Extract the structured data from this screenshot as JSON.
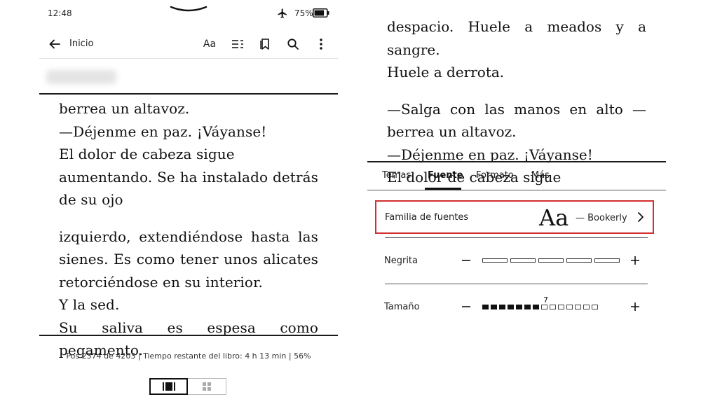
{
  "status_bar": {
    "time": "12:48",
    "battery": "75%",
    "icons": [
      "pull-down-handle-icon",
      "airplane-mode-icon",
      "battery-icon"
    ]
  },
  "toolbar": {
    "home_label": "Inicio",
    "font_button_label": "Aa",
    "icons": [
      "back-arrow-icon",
      "table-of-contents-icon",
      "bookmark-icon",
      "search-icon",
      "more-options-icon"
    ]
  },
  "reader_left": {
    "paragraphs": [
      [
        "berrea un altavoz.",
        "—Déjenme en paz. ¡Váyanse!",
        "El dolor de cabeza sigue",
        "aumentando. Se ha instalado detrás",
        "de su ojo"
      ],
      [
        "izquierdo, extendiéndose hasta las",
        "sienes. Es como tener unos alicates",
        "retorciéndose en su interior.",
        "Y la sed.",
        "Su saliva es espesa como pegamento."
      ]
    ],
    "progress": "Pos 2374 de 4203 | Tiempo restante del libro: 4 h 13 min | 56%"
  },
  "view_toggle": {
    "active": "page-view",
    "icons": [
      "page-view-icon",
      "grid-view-icon"
    ]
  },
  "reader_right": {
    "paragraphs": [
      [
        "despacio. Huele a meados y a sangre.",
        "Huele a derrota."
      ],
      [
        "—Salga con las manos en alto —",
        "berrea un altavoz.",
        "—Déjenme en paz. ¡Váyanse!",
        "El dolor de cabeza sigue"
      ]
    ]
  },
  "settings": {
    "tabs": [
      "Temas",
      "Fuente",
      "Formato",
      "Más"
    ],
    "active_tab": "Fuente",
    "font_family": {
      "label": "Familia de fuentes",
      "sample": "Aa",
      "value": "— Bookerly"
    },
    "bold": {
      "label": "Negrita",
      "levels": 5,
      "current": 0
    },
    "size": {
      "label": "Tamaño",
      "levels": 14,
      "current": 7,
      "current_label": "7"
    },
    "highlight_color": "#d32f2f"
  }
}
